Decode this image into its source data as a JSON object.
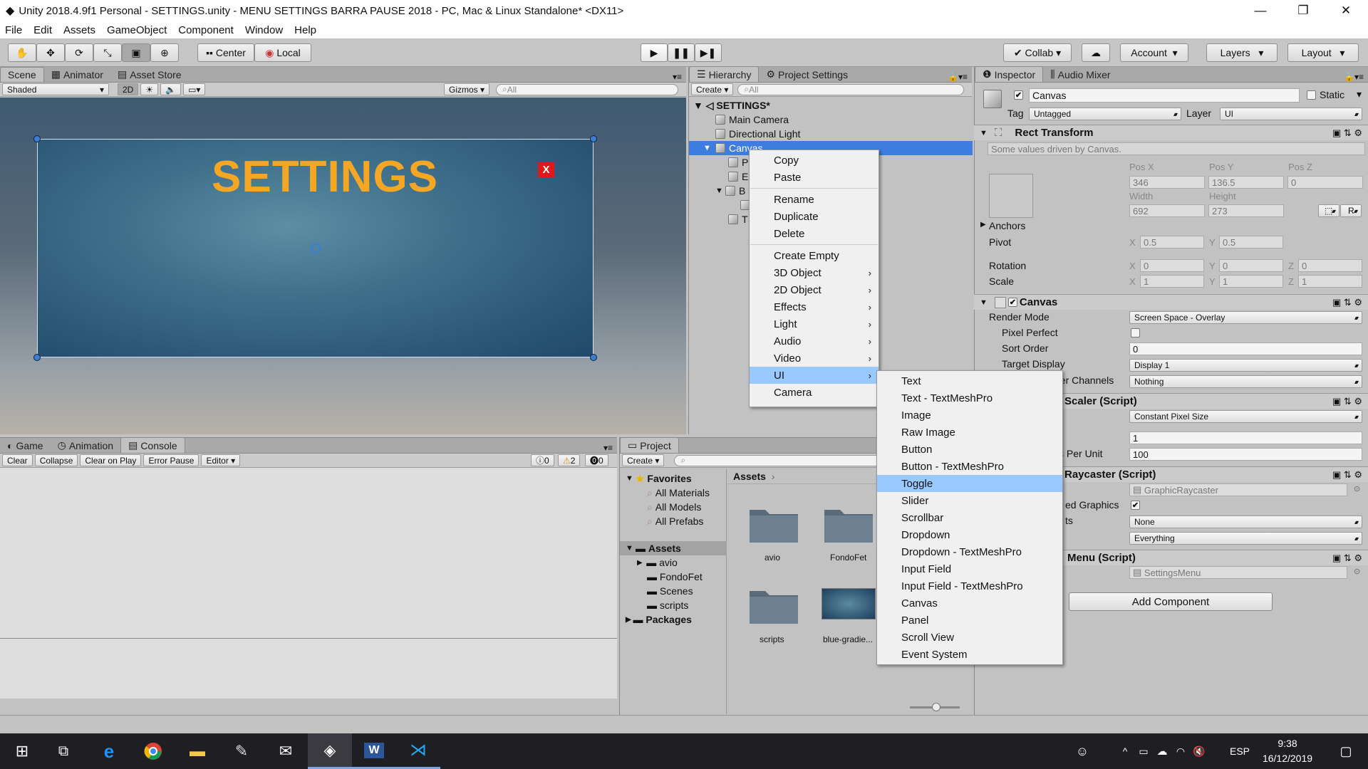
{
  "window": {
    "title": "Unity 2018.4.9f1 Personal - SETTINGS.unity - MENU SETTINGS BARRA PAUSE 2018 - PC, Mac & Linux Standalone* <DX11>",
    "controls": {
      "minimize": "—",
      "maximize": "❐",
      "close": "✕"
    }
  },
  "menubar": [
    "File",
    "Edit",
    "Assets",
    "GameObject",
    "Component",
    "Window",
    "Help"
  ],
  "toolbar": {
    "pivot": "Center",
    "space": "Local",
    "collab": "Collab",
    "account": "Account",
    "layers": "Layers",
    "layout": "Layout"
  },
  "scene_panel": {
    "tabs": [
      "Scene",
      "Animator",
      "Asset Store"
    ],
    "shading": "Shaded",
    "mode_2d": "2D",
    "gizmos": "Gizmos",
    "search_placeholder": "All",
    "canvas_title": "SETTINGS",
    "close_button": "X"
  },
  "hierarchy": {
    "tabs": [
      "Hierarchy",
      "Project Settings"
    ],
    "create": "Create",
    "search_placeholder": "All",
    "scene_name": "SETTINGS*",
    "items": [
      {
        "label": "Main Camera"
      },
      {
        "label": "Directional Light"
      },
      {
        "label": "Canvas"
      }
    ],
    "partial_children": [
      "P",
      "E",
      "B",
      "",
      "T"
    ]
  },
  "context_menu": {
    "items": [
      "Copy",
      "Paste",
      "Rename",
      "Duplicate",
      "Delete",
      "Create Empty",
      "3D Object",
      "2D Object",
      "Effects",
      "Light",
      "Audio",
      "Video",
      "UI",
      "Camera"
    ],
    "highlighted": "UI"
  },
  "ui_submenu": {
    "items": [
      "Text",
      "Text - TextMeshPro",
      "Image",
      "Raw Image",
      "Button",
      "Button - TextMeshPro",
      "Toggle",
      "Slider",
      "Scrollbar",
      "Dropdown",
      "Dropdown - TextMeshPro",
      "Input Field",
      "Input Field - TextMeshPro",
      "Canvas",
      "Panel",
      "Scroll View",
      "Event System"
    ],
    "highlighted": "Toggle"
  },
  "inspector": {
    "tabs": [
      "Inspector",
      "Audio Mixer"
    ],
    "object_name": "Canvas",
    "static_label": "Static",
    "tag_label": "Tag",
    "tag_value": "Untagged",
    "layer_label": "Layer",
    "layer_value": "UI",
    "rect_transform": {
      "header": "Rect Transform",
      "note": "Some values driven by Canvas.",
      "pos_x_label": "Pos X",
      "pos_y_label": "Pos Y",
      "pos_z_label": "Pos Z",
      "pos_x": "346",
      "pos_y": "136.5",
      "pos_z": "0",
      "width_label": "Width",
      "height_label": "Height",
      "width": "692",
      "height": "273",
      "anchors": "Anchors",
      "pivot": "Pivot",
      "pivot_x": "0.5",
      "pivot_y": "0.5",
      "rotation": "Rotation",
      "rot_x": "0",
      "rot_y": "0",
      "rot_z": "0",
      "scale": "Scale",
      "scale_x": "1",
      "scale_y": "1",
      "scale_z": "1",
      "r_button": "R"
    },
    "canvas": {
      "header": "Canvas",
      "render_mode_label": "Render Mode",
      "render_mode": "Screen Space - Overlay",
      "pixel_perfect_label": "Pixel Perfect",
      "sort_order_label": "Sort Order",
      "sort_order": "0",
      "target_display_label": "Target Display",
      "target_display": "Display 1",
      "channels_label": "der Channels",
      "channels": "Nothing"
    },
    "scaler": {
      "header": "Scaler (Script)",
      "mode": "Constant Pixel Size",
      "scale_factor": "1",
      "ppu_label": "s Per Unit",
      "ppu": "100"
    },
    "raycaster": {
      "header": "Raycaster (Script)",
      "script": "GraphicRaycaster",
      "graphics_label": "ed Graphics",
      "objects_label": "ts",
      "objects": "None",
      "mask": "Everything"
    },
    "menu_script": {
      "header": "Menu (Script)",
      "script": "SettingsMenu"
    },
    "add_component": "Add Component"
  },
  "console": {
    "tabs": [
      "Game",
      "Animation",
      "Console"
    ],
    "buttons": [
      "Clear",
      "Collapse",
      "Clear on Play",
      "Error Pause",
      "Editor"
    ],
    "counts": {
      "info": "0",
      "warn": "2",
      "error": "0"
    }
  },
  "project": {
    "tab": "Project",
    "create": "Create",
    "favorites": "Favorites",
    "fav_items": [
      "All Materials",
      "All Models",
      "All Prefabs"
    ],
    "assets": "Assets",
    "asset_children": [
      "avio",
      "FondoFet",
      "Scenes",
      "scripts"
    ],
    "packages": "Packages",
    "breadcrumb": "Assets",
    "grid": [
      "avio",
      "FondoFet",
      "scripts",
      "blue-gradie..."
    ]
  },
  "taskbar": {
    "lang": "ESP",
    "time": "9:38",
    "date": "16/12/2019"
  },
  "colors": {
    "title_accent": "#f5a623",
    "selection": "#3e7de0",
    "menu_highlight": "#99c9ff"
  }
}
